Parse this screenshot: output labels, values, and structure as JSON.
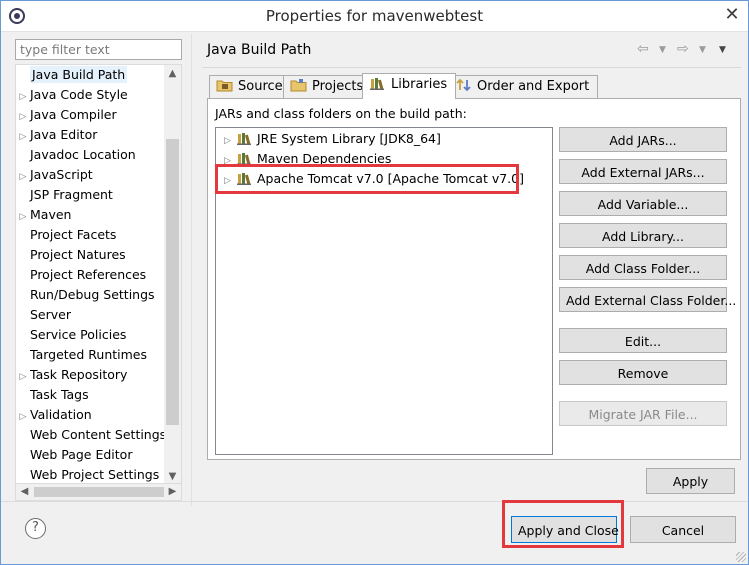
{
  "window": {
    "title": "Properties for mavenwebtest",
    "close_glyph": "✕"
  },
  "filter": {
    "placeholder": "type filter text"
  },
  "tree": {
    "items": [
      {
        "label": "Java Build Path",
        "expandable": false,
        "selected": true
      },
      {
        "label": "Java Code Style",
        "expandable": true
      },
      {
        "label": "Java Compiler",
        "expandable": true
      },
      {
        "label": "Java Editor",
        "expandable": true
      },
      {
        "label": "Javadoc Location",
        "expandable": false
      },
      {
        "label": "JavaScript",
        "expandable": true
      },
      {
        "label": "JSP Fragment",
        "expandable": false
      },
      {
        "label": "Maven",
        "expandable": true
      },
      {
        "label": "Project Facets",
        "expandable": false
      },
      {
        "label": "Project Natures",
        "expandable": false
      },
      {
        "label": "Project References",
        "expandable": false
      },
      {
        "label": "Run/Debug Settings",
        "expandable": false
      },
      {
        "label": "Server",
        "expandable": false
      },
      {
        "label": "Service Policies",
        "expandable": false
      },
      {
        "label": "Targeted Runtimes",
        "expandable": false
      },
      {
        "label": "Task Repository",
        "expandable": true
      },
      {
        "label": "Task Tags",
        "expandable": false
      },
      {
        "label": "Validation",
        "expandable": true
      },
      {
        "label": "Web Content Settings",
        "expandable": false
      },
      {
        "label": "Web Page Editor",
        "expandable": false
      },
      {
        "label": "Web Project Settings",
        "expandable": false
      }
    ]
  },
  "page": {
    "title": "Java Build Path"
  },
  "tabs": [
    {
      "label": "Source",
      "active": false
    },
    {
      "label": "Projects",
      "active": false
    },
    {
      "label": "Libraries",
      "active": true
    },
    {
      "label": "Order and Export",
      "active": false
    }
  ],
  "libraries": {
    "heading": "JARs and class folders on the build path:",
    "items": [
      {
        "label": "JRE System Library [JDK8_64]"
      },
      {
        "label": "Maven Dependencies"
      },
      {
        "label": "Apache Tomcat v7.0 [Apache Tomcat v7.0]",
        "highlighted": true
      }
    ]
  },
  "buttons": {
    "add_jars": "Add JARs...",
    "add_external_jars": "Add External JARs...",
    "add_variable": "Add Variable...",
    "add_library": "Add Library...",
    "add_class_folder": "Add Class Folder...",
    "add_external_class_folder": "Add External Class Folder...",
    "edit": "Edit...",
    "remove": "Remove",
    "migrate_jar": "Migrate JAR File...",
    "apply": "Apply",
    "apply_and_close": "Apply and Close",
    "cancel": "Cancel"
  },
  "colors": {
    "highlight_border": "#e3383e",
    "selection_bg": "#e5f1fb",
    "button_bg": "#e1e1e1"
  }
}
